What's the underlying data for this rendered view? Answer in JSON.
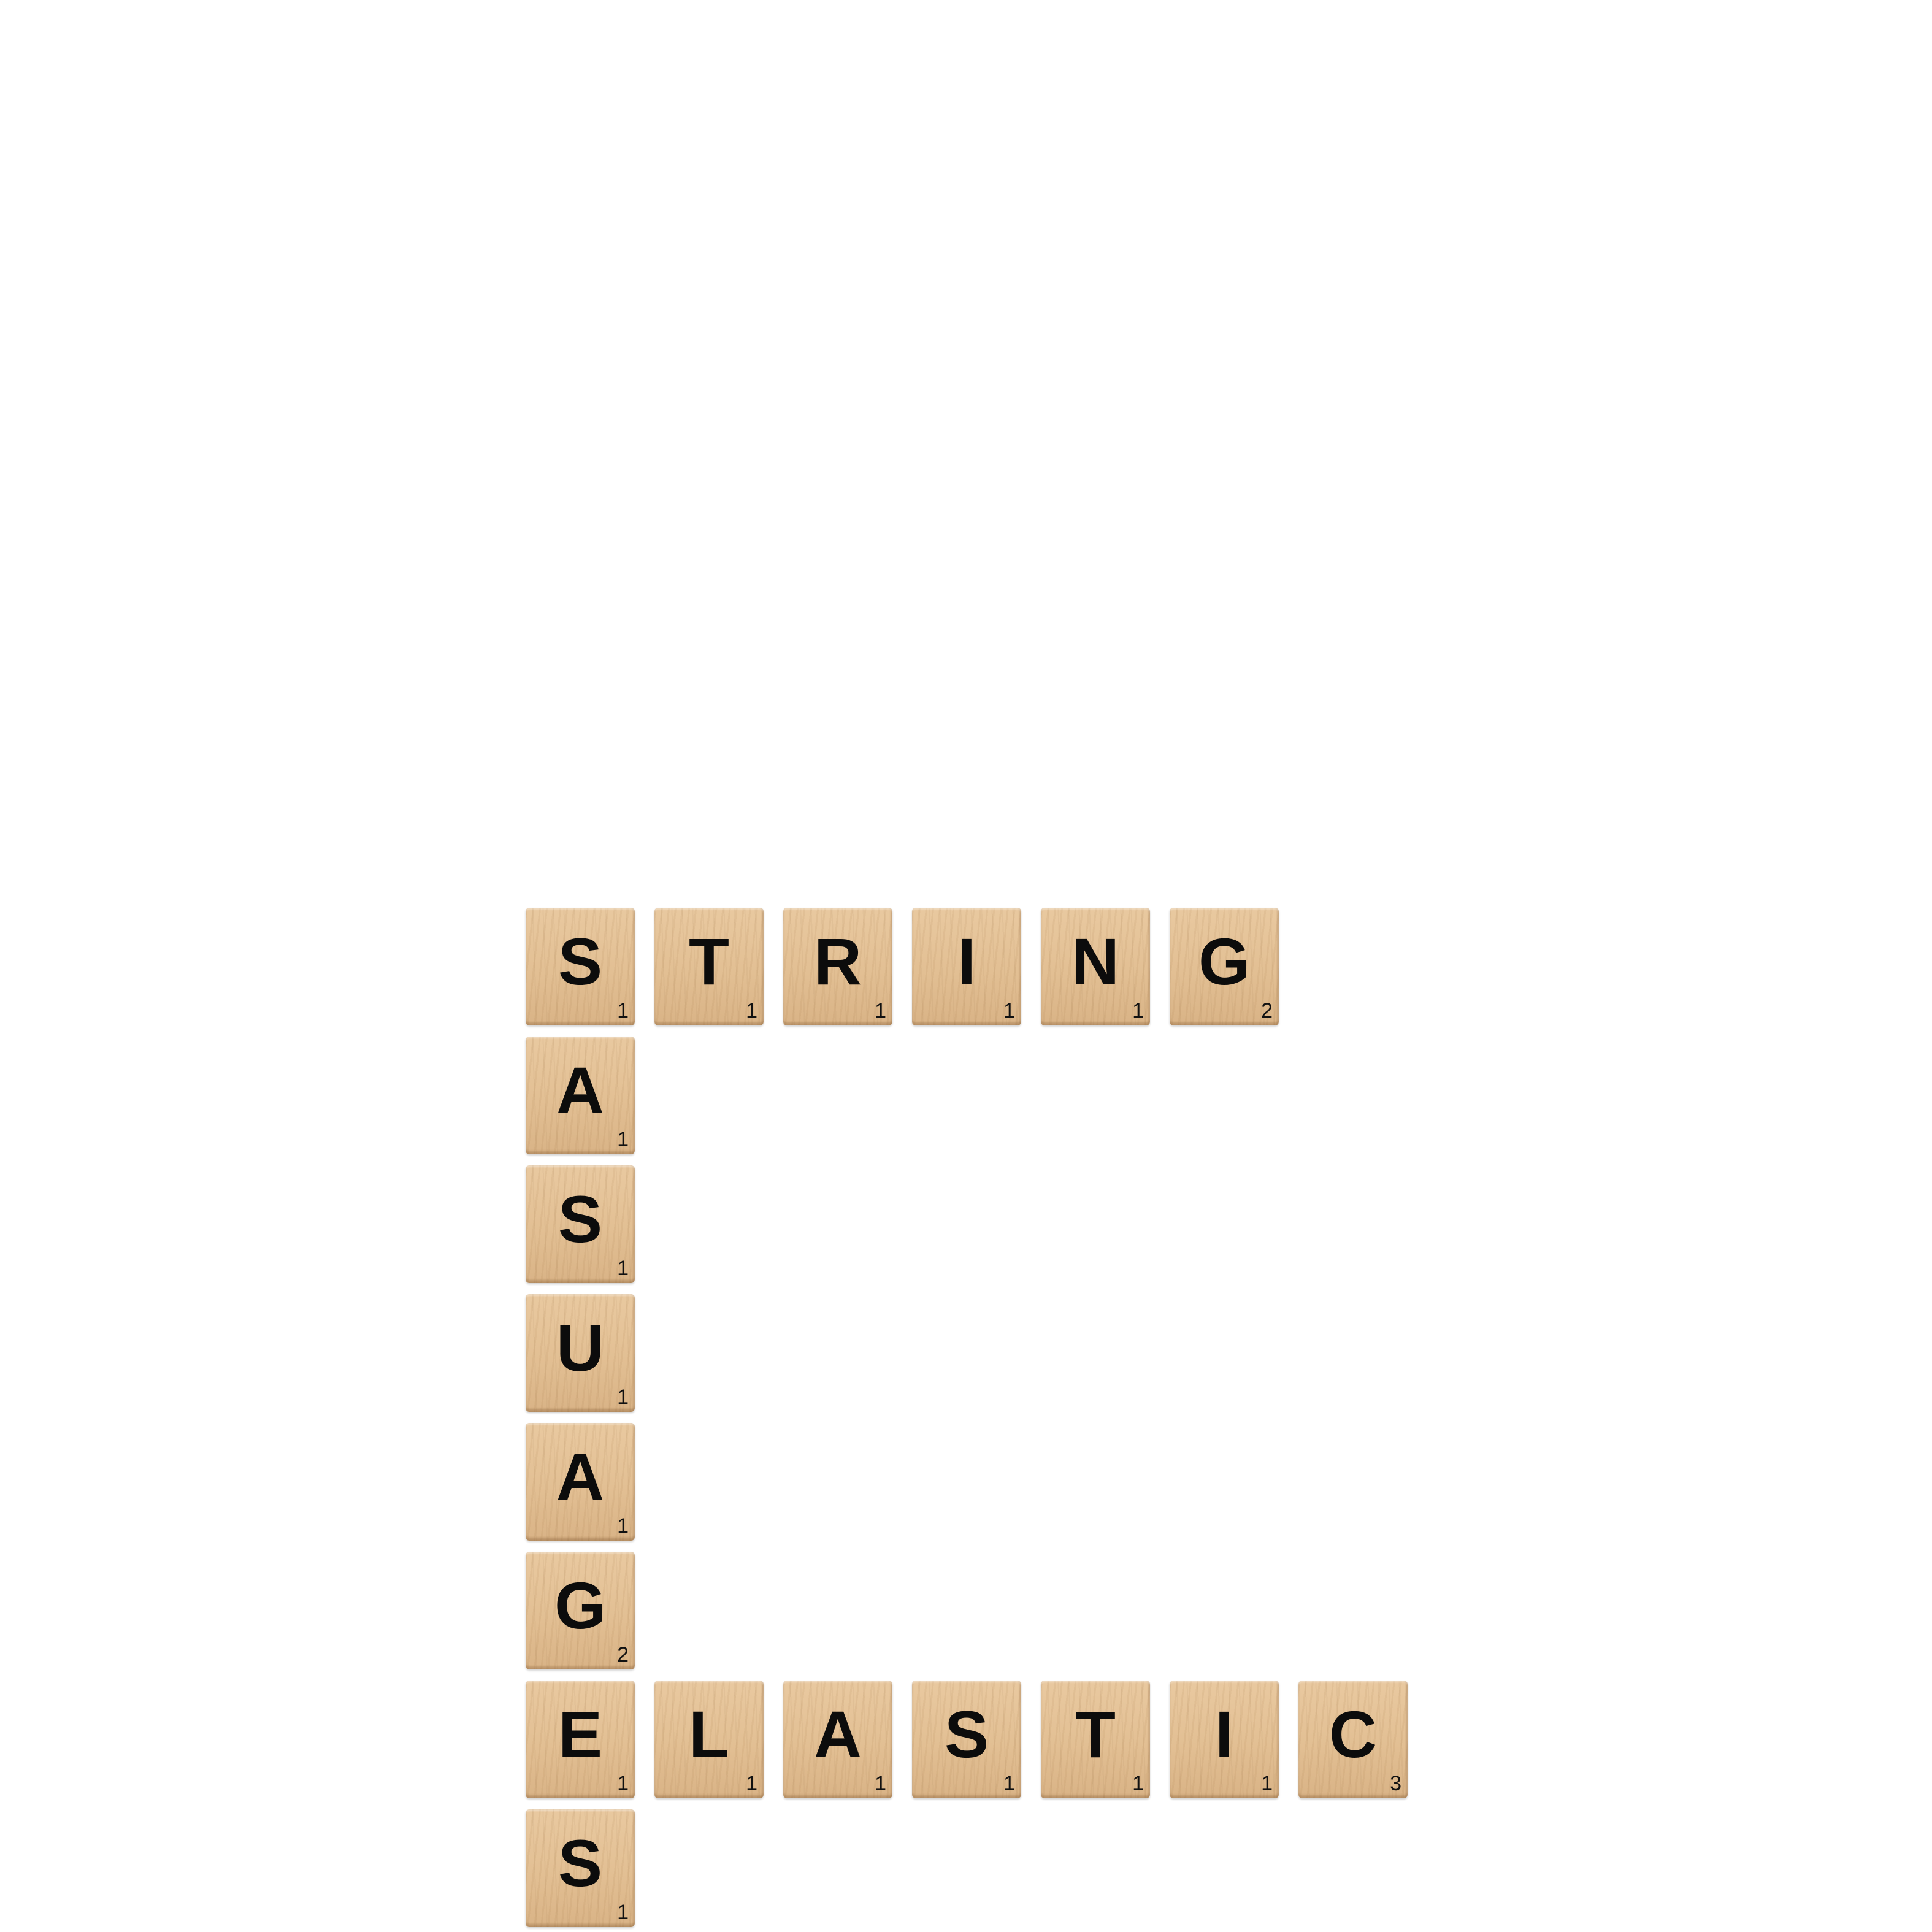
{
  "board": {
    "background": "#ffffff",
    "tile_color": "#e2bf93",
    "letter_color": "#0c0c0c"
  },
  "words": [
    {
      "id": "string",
      "direction": "across",
      "tiles": [
        {
          "letter": "S",
          "score": "1"
        },
        {
          "letter": "T",
          "score": "1"
        },
        {
          "letter": "R",
          "score": "1"
        },
        {
          "letter": "I",
          "score": "1"
        },
        {
          "letter": "N",
          "score": "1"
        },
        {
          "letter": "G",
          "score": "2"
        }
      ]
    },
    {
      "id": "sausages",
      "direction": "down",
      "tiles": [
        {
          "letter": "S",
          "score": "1"
        },
        {
          "letter": "A",
          "score": "1"
        },
        {
          "letter": "S",
          "score": "1"
        },
        {
          "letter": "U",
          "score": "1"
        },
        {
          "letter": "A",
          "score": "1"
        },
        {
          "letter": "G",
          "score": "2"
        },
        {
          "letter": "E",
          "score": "1"
        },
        {
          "letter": "S",
          "score": "1"
        }
      ]
    },
    {
      "id": "elastic",
      "direction": "across",
      "tiles": [
        {
          "letter": "E",
          "score": "1"
        },
        {
          "letter": "L",
          "score": "1"
        },
        {
          "letter": "A",
          "score": "1"
        },
        {
          "letter": "S",
          "score": "1"
        },
        {
          "letter": "T",
          "score": "1"
        },
        {
          "letter": "I",
          "score": "1"
        },
        {
          "letter": "C",
          "score": "3"
        }
      ]
    }
  ]
}
